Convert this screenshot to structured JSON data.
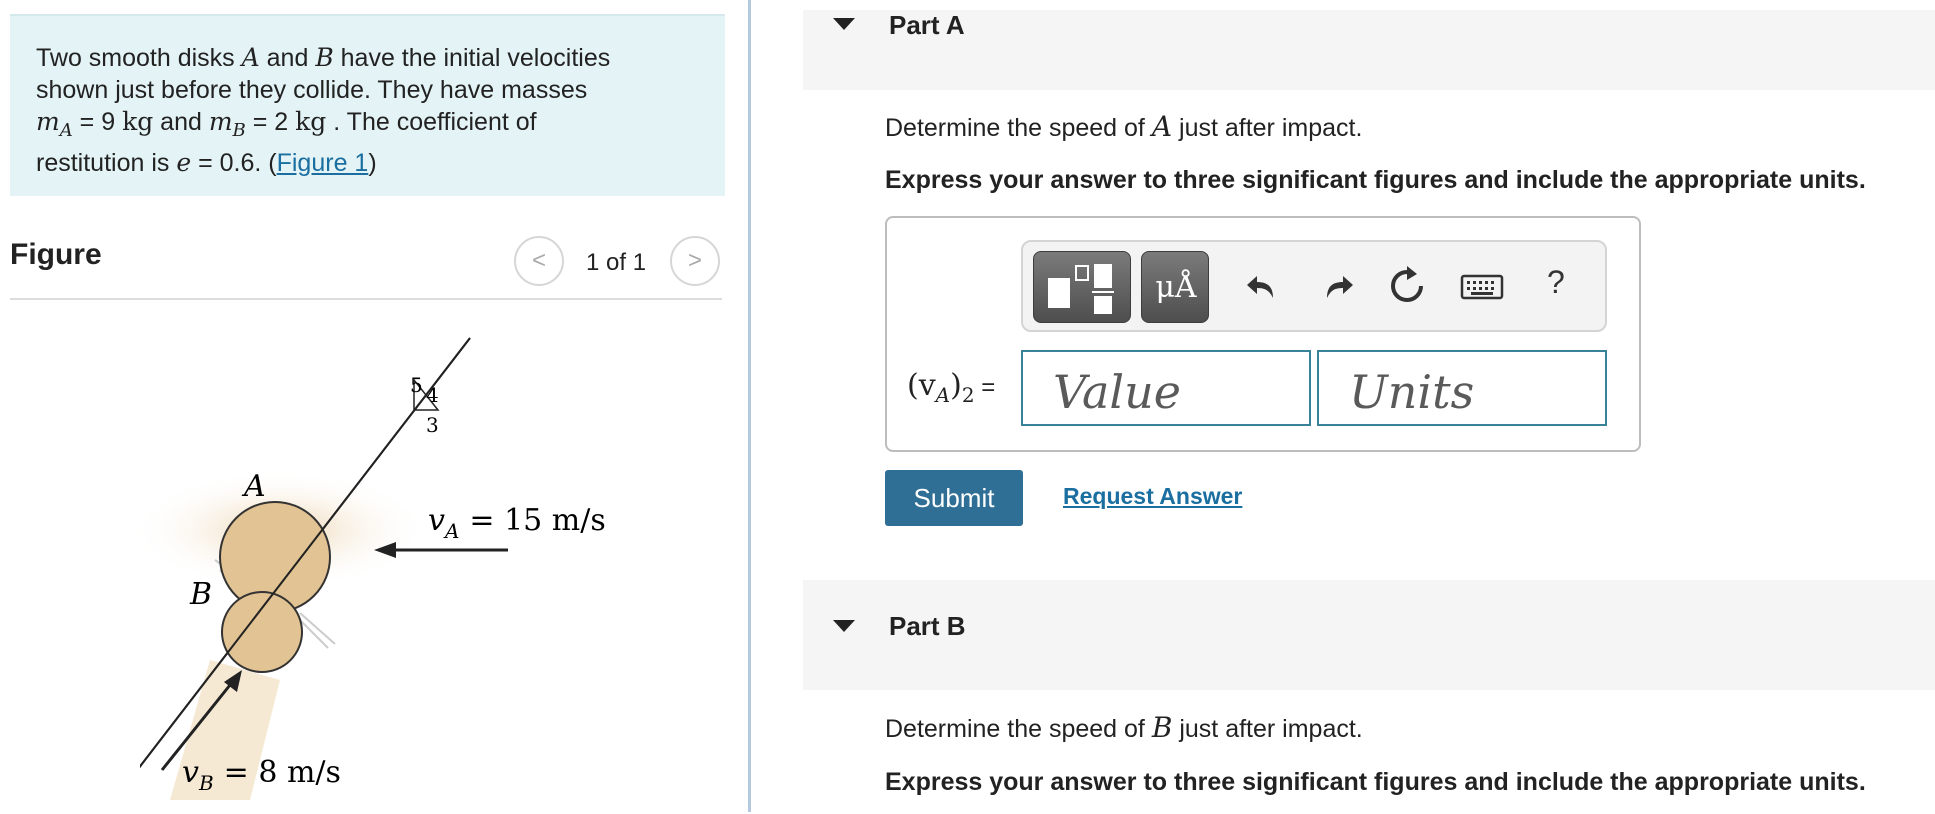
{
  "problem": {
    "intro": "Two smooth disks ",
    "var_a": "A",
    "and": " and ",
    "var_b": "B",
    "line1_end": " have the initial velocities",
    "line2": "shown just before they collide. They have masses",
    "ma_symbol": "m",
    "ma_sub": "A",
    "ma_value": " = 9 ",
    "ma_unit": "kg",
    "and2": " and ",
    "mb_symbol": "m",
    "mb_sub": "B",
    "mb_value": " = 2 ",
    "mb_unit": "kg",
    "line3_end": " . The coefficient of",
    "line4_start": "restitution is ",
    "e_symbol": "e",
    "e_value": " = 0.6. (",
    "figure_link": "Figure 1",
    "close_paren": ")"
  },
  "figure": {
    "title": "Figure",
    "pager": "1 of 1",
    "prev_symbol": "<",
    "next_symbol": ">",
    "slope_hyp": "5",
    "slope_vert": "4",
    "slope_horiz": "3",
    "label_a": "A",
    "label_b": "B",
    "va_label": "v",
    "va_sub": "A",
    "va_value": "= 15 m/s",
    "vb_label": "v",
    "vb_sub": "B",
    "vb_value": "= 8 m/s",
    "colors": {
      "disk": "#e2c393",
      "shadow": "#f1dfc2",
      "line": "#222222"
    }
  },
  "part_a": {
    "label": "Part A",
    "question_pre": "Determine the speed of ",
    "question_var": "A",
    "question_post": " just after impact.",
    "instruction": "Express your answer to three significant figures and include the appropriate units.",
    "var_label": "(v",
    "var_sub": "A",
    "var_label_end": ")",
    "var_sub2": "2",
    "equals": " =",
    "value_placeholder": "Value",
    "units_placeholder": "Units",
    "units_button": "μÅ",
    "help": "?",
    "submit": "Submit",
    "request": "Request Answer"
  },
  "part_b": {
    "label": "Part B",
    "question_pre": "Determine the speed of ",
    "question_var": "B",
    "question_post": " just after impact.",
    "instruction": "Express your answer to three significant figures and include the appropriate units."
  },
  "colors": {
    "accent": "#2f6f95",
    "link": "#1a6ea0",
    "problem_bg": "#e4f4f6"
  }
}
